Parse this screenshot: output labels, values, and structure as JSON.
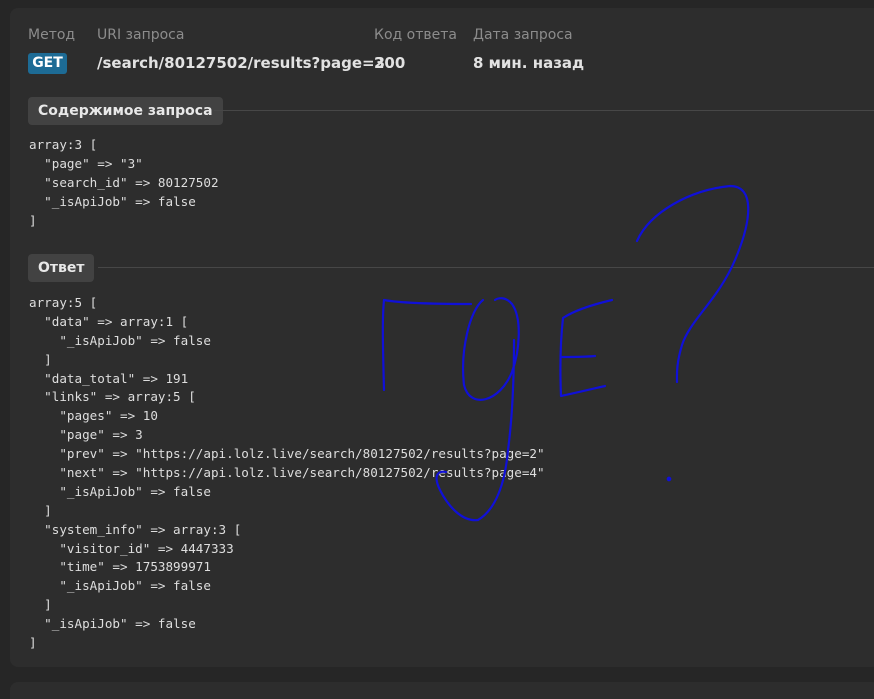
{
  "request": {
    "method_label": "Метод",
    "uri_label": "URI запроса",
    "status_label": "Код ответа",
    "date_label": "Дата запроса",
    "method": "GET",
    "uri": "/search/80127502/results?page=3",
    "status": "200",
    "date": "8 мин. назад",
    "method_badge_color": "#1d6b95"
  },
  "request_body": {
    "title": "Содержимое запроса",
    "lines": [
      "array:3 [",
      "  \"page\" => \"3\"",
      "  \"search_id\" => 80127502",
      "  \"_isApiJob\" => false",
      "]"
    ]
  },
  "response": {
    "title": "Ответ",
    "lines": [
      "array:5 [",
      "  \"data\" => array:1 [",
      "    \"_isApiJob\" => false",
      "  ]",
      "  \"data_total\" => 191",
      "  \"links\" => array:5 [",
      "    \"pages\" => 10",
      "    \"page\" => 3",
      "    \"prev\" => \"https://api.lolz.live/search/80127502/results?page=2\"",
      "    \"next\" => \"https://api.lolz.live/search/80127502/results?page=4\"",
      "    \"_isApiJob\" => false",
      "  ]",
      "  \"system_info\" => array:3 [",
      "    \"visitor_id\" => 4447333",
      "    \"time\" => 1753899971",
      "    \"_isApiJob\" => false",
      "  ]",
      "  \"_isApiJob\" => false",
      "]"
    ]
  },
  "annotation": {
    "text": "где?",
    "color": "#1010d8"
  }
}
